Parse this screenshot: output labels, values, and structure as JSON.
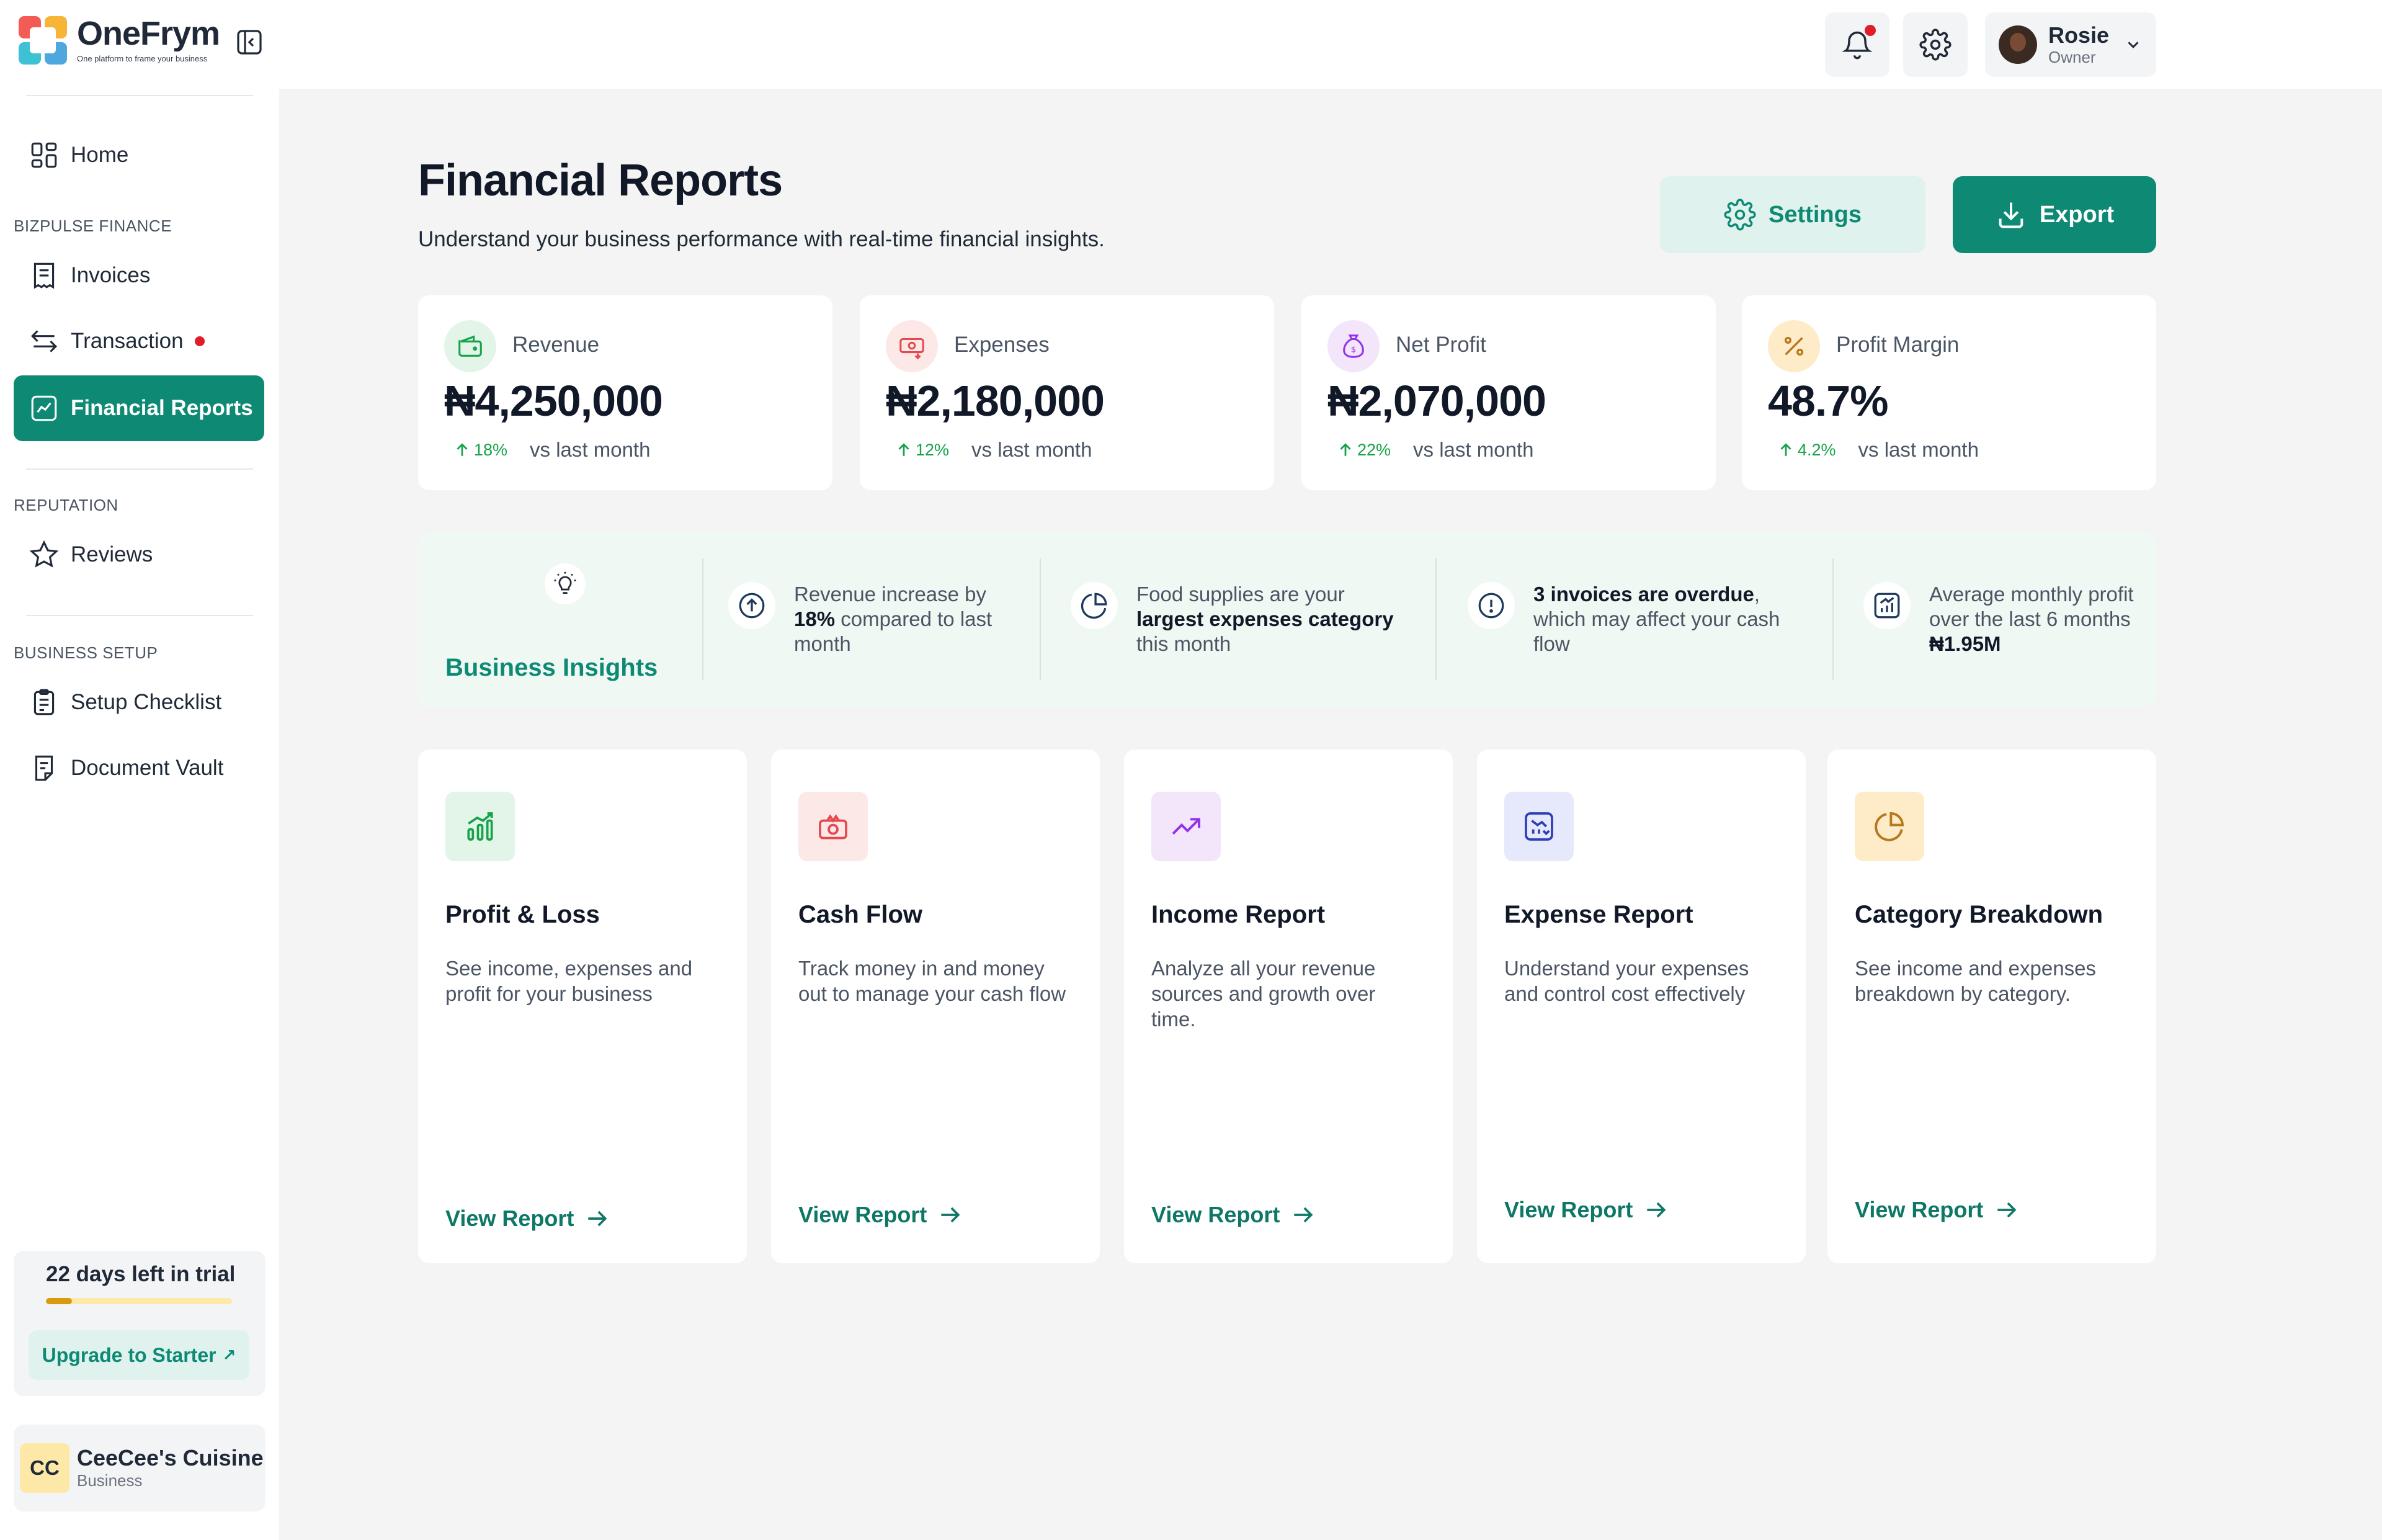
{
  "app": {
    "name": "OneFrym",
    "tagline": "One platform to frame your business"
  },
  "user": {
    "name": "Rosie",
    "role": "Owner"
  },
  "sidebar": {
    "home": "Home",
    "section_finance": "BIZPULSE FINANCE",
    "invoices": "Invoices",
    "transaction": "Transaction",
    "financial_reports": "Financial Reports",
    "section_reputation": "REPUTATION",
    "reviews": "Reviews",
    "section_setup": "BUSINESS SETUP",
    "setup_checklist": "Setup Checklist",
    "document_vault": "Document Vault",
    "trial": {
      "text": "22 days left in trial",
      "progress": 0.14,
      "upgrade_label": "Upgrade to Starter"
    },
    "business": {
      "initials": "CC",
      "name": "CeeCee's Cuisine",
      "type": "Business"
    }
  },
  "page": {
    "title": "Financial Reports",
    "subtitle": "Understand your business performance with real-time financial insights.",
    "settings_label": "Settings",
    "export_label": "Export"
  },
  "stats": [
    {
      "label": "Revenue",
      "value": "₦4,250,000",
      "change": "18%",
      "vs": "vs last month",
      "icon": "wallet-icon",
      "color": "#16a34a"
    },
    {
      "label": "Expenses",
      "value": "₦2,180,000",
      "change": "12%",
      "vs": "vs last month",
      "icon": "money-out-icon",
      "color": "#e5484d"
    },
    {
      "label": "Net Profit",
      "value": "₦2,070,000",
      "change": "22%",
      "vs": "vs last month",
      "icon": "money-bag-icon",
      "color": "#9333ea"
    },
    {
      "label": "Profit Margin",
      "value": "48.7%",
      "change": "4.2%",
      "vs": "vs last month",
      "icon": "percent-icon",
      "color": "#b7791f"
    }
  ],
  "insights": {
    "title": "Business Insights",
    "revenue": {
      "pre": "Revenue increase by ",
      "bold": "18%",
      "post": " compared to last month"
    },
    "food": {
      "pre": "Food supplies are your ",
      "bold": "largest expenses category",
      "post": " this month"
    },
    "invoices": {
      "pre": "",
      "bold": "3 invoices are overdue",
      "post": ", which may affect your cash flow"
    },
    "profit": {
      "pre": "Average monthly profit over the last 6 months ",
      "bold": "₦1.95M",
      "post": ""
    }
  },
  "reports": [
    {
      "title": "Profit & Loss",
      "desc": "See income, expenses and profit for your business",
      "link": "View Report",
      "icon": "bar-chart-icon",
      "color": "#16a34a"
    },
    {
      "title": "Cash Flow",
      "desc": "Track money in and money out to manage your cash flow",
      "link": "View Report",
      "icon": "cash-icon",
      "color": "#e5484d"
    },
    {
      "title": "Income Report",
      "desc": "Analyze all your revenue sources and growth over time.",
      "link": "View Report",
      "icon": "trend-up-icon",
      "color": "#9333ea"
    },
    {
      "title": "Expense Report",
      "desc": "Understand your expenses and control cost effectively",
      "link": "View Report",
      "icon": "expense-chart-icon",
      "color": "#2f3fb8"
    },
    {
      "title": "Category Breakdown",
      "desc": "See income and expenses breakdown by category.",
      "link": "View Report",
      "icon": "pie-chart-icon",
      "color": "#b7791f"
    }
  ]
}
